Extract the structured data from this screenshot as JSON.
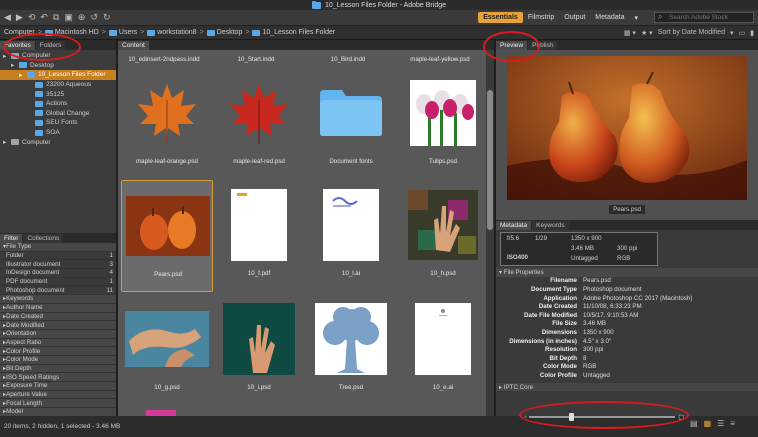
{
  "window": {
    "title": "10_Lesson Files Folder - Adobe Bridge"
  },
  "toolbar": {
    "workspaces": [
      "Essentials",
      "Filmstrip",
      "Output",
      "Metadata"
    ],
    "active_workspace": "Essentials",
    "search_placeholder": "Search Adobe Stock"
  },
  "path": {
    "crumbs": [
      "Computer",
      "Macintosh HD",
      "Users",
      "workstation8",
      "Desktop",
      "10_Lesson Files Folder"
    ],
    "sort_label": "Sort by Date Modified"
  },
  "left": {
    "tabs": [
      "Favorites",
      "Folders"
    ],
    "tree": [
      {
        "label": "Computer",
        "indent": 0
      },
      {
        "label": "Desktop",
        "indent": 1
      },
      {
        "label": "10_Lesson Files Folder",
        "indent": 2,
        "selected": true
      },
      {
        "label": "23200 Aqueous",
        "indent": 3
      },
      {
        "label": "35125",
        "indent": 3
      },
      {
        "label": "Actions",
        "indent": 3
      },
      {
        "label": "Global Change",
        "indent": 3
      },
      {
        "label": "SEU Fonts",
        "indent": 3
      },
      {
        "label": "SOA",
        "indent": 3
      },
      {
        "label": "Computer",
        "indent": 0
      }
    ],
    "filter_tabs": [
      "Filter",
      "Collections"
    ],
    "filter_rows": [
      {
        "label": "File Type",
        "count": "",
        "head": true
      },
      {
        "label": "Folder",
        "count": "1"
      },
      {
        "label": "Illustrator document",
        "count": "3"
      },
      {
        "label": "InDesign document",
        "count": "4"
      },
      {
        "label": "PDF document",
        "count": "1"
      },
      {
        "label": "Photoshop document",
        "count": "11"
      },
      {
        "label": "Keywords",
        "count": "",
        "head": true
      },
      {
        "label": "Author Name",
        "count": "",
        "head": true
      },
      {
        "label": "Date Created",
        "count": "",
        "head": true
      },
      {
        "label": "Date Modified",
        "count": "",
        "head": true
      },
      {
        "label": "Orientation",
        "count": "",
        "head": true
      },
      {
        "label": "Aspect Ratio",
        "count": "",
        "head": true
      },
      {
        "label": "Color Profile",
        "count": "",
        "head": true
      },
      {
        "label": "Color Mode",
        "count": "",
        "head": true
      },
      {
        "label": "Bit Depth",
        "count": "",
        "head": true
      },
      {
        "label": "ISO Speed Ratings",
        "count": "",
        "head": true
      },
      {
        "label": "Exposure Time",
        "count": "",
        "head": true
      },
      {
        "label": "Aperture Value",
        "count": "",
        "head": true
      },
      {
        "label": "Focal Length",
        "count": "",
        "head": true
      },
      {
        "label": "Model",
        "count": "",
        "head": true
      },
      {
        "label": "White Balance",
        "count": "",
        "head": true
      }
    ]
  },
  "content": {
    "tab": "Content",
    "top_row": [
      "10_edinsert-2ndpass.indd",
      "10_Start.indd",
      "10_Bird.indd",
      "maple-leaf-yellow.psd"
    ],
    "items": [
      {
        "name": "maple-leaf-orange.psd",
        "kind": "leaf-orange"
      },
      {
        "name": "maple-leaf-red.psd",
        "kind": "leaf-red"
      },
      {
        "name": "Document fonts",
        "kind": "folder"
      },
      {
        "name": "Tulips.psd",
        "kind": "tulips"
      },
      {
        "name": "Pears.psd",
        "kind": "pears",
        "selected": true
      },
      {
        "name": "10_f.pdf",
        "kind": "page"
      },
      {
        "name": "10_l.ai",
        "kind": "page-bird"
      },
      {
        "name": "10_h.psd",
        "kind": "hand-mosaic"
      },
      {
        "name": "10_g.psd",
        "kind": "hands"
      },
      {
        "name": "10_i.psd",
        "kind": "hand-dark"
      },
      {
        "name": "Tree.psd",
        "kind": "tree"
      },
      {
        "name": "10_e.ai",
        "kind": "page-small"
      }
    ]
  },
  "right": {
    "tabs": [
      "Preview",
      "Publish"
    ],
    "preview_caption": "Pears.psd",
    "meta_tabs": [
      "Metadata",
      "Keywords"
    ],
    "placard": {
      "aperture": "f/5.6",
      "shutter": "1/29",
      "dims": "1350 x 900",
      "size": "3.46 MB",
      "ppi": "300 ppi",
      "iso": "ISO400",
      "tag": "Untagged",
      "mode": "RGB"
    },
    "section": "File Properties",
    "props": [
      {
        "k": "Filename",
        "v": "Pears.psd"
      },
      {
        "k": "Document Type",
        "v": "Photoshop document"
      },
      {
        "k": "Application",
        "v": "Adobe Photoshop CC 2017 (Macintosh)"
      },
      {
        "k": "Date Created",
        "v": "11/10/08, 6:33:23 PM"
      },
      {
        "k": "Date File Modified",
        "v": "10/5/17, 9:10:53 AM"
      },
      {
        "k": "File Size",
        "v": "3.46 MB"
      },
      {
        "k": "Dimensions",
        "v": "1350 x 900"
      },
      {
        "k": "Dimensions (in inches)",
        "v": "4.5\" x 3.0\""
      },
      {
        "k": "Resolution",
        "v": "300 ppi"
      },
      {
        "k": "Bit Depth",
        "v": "8"
      },
      {
        "k": "Color Mode",
        "v": "RGB"
      },
      {
        "k": "Color Profile",
        "v": "Untagged"
      }
    ],
    "iptc": "IPTC Core"
  },
  "status": {
    "text": "20 items, 2 hidden, 1 selected - 3.46 MB"
  },
  "colors": {
    "accent": "#e8a23a",
    "selection": "#c87f1f",
    "annotation": "#d81b1b"
  }
}
